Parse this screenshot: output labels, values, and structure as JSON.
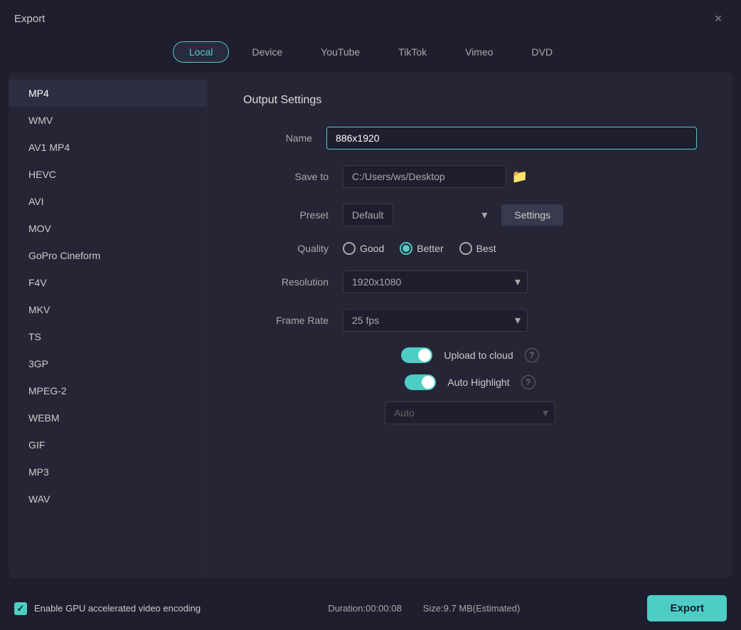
{
  "window": {
    "title": "Export",
    "close_icon": "×"
  },
  "tabs": [
    {
      "id": "local",
      "label": "Local",
      "active": true
    },
    {
      "id": "device",
      "label": "Device",
      "active": false
    },
    {
      "id": "youtube",
      "label": "YouTube",
      "active": false
    },
    {
      "id": "tiktok",
      "label": "TikTok",
      "active": false
    },
    {
      "id": "vimeo",
      "label": "Vimeo",
      "active": false
    },
    {
      "id": "dvd",
      "label": "DVD",
      "active": false
    }
  ],
  "formats": [
    {
      "label": "MP4",
      "active": true
    },
    {
      "label": "WMV",
      "active": false
    },
    {
      "label": "AV1 MP4",
      "active": false
    },
    {
      "label": "HEVC",
      "active": false
    },
    {
      "label": "AVI",
      "active": false
    },
    {
      "label": "MOV",
      "active": false
    },
    {
      "label": "GoPro Cineform",
      "active": false
    },
    {
      "label": "F4V",
      "active": false
    },
    {
      "label": "MKV",
      "active": false
    },
    {
      "label": "TS",
      "active": false
    },
    {
      "label": "3GP",
      "active": false
    },
    {
      "label": "MPEG-2",
      "active": false
    },
    {
      "label": "WEBM",
      "active": false
    },
    {
      "label": "GIF",
      "active": false
    },
    {
      "label": "MP3",
      "active": false
    },
    {
      "label": "WAV",
      "active": false
    }
  ],
  "settings": {
    "title": "Output Settings",
    "name_label": "Name",
    "name_value": "886x1920",
    "save_to_label": "Save to",
    "save_to_value": "C:/Users/ws/Desktop",
    "preset_label": "Preset",
    "preset_value": "Default",
    "settings_button": "Settings",
    "quality_label": "Quality",
    "quality_options": [
      {
        "id": "good",
        "label": "Good",
        "selected": false
      },
      {
        "id": "better",
        "label": "Better",
        "selected": true
      },
      {
        "id": "best",
        "label": "Best",
        "selected": false
      }
    ],
    "resolution_label": "Resolution",
    "resolution_value": "1920x1080",
    "frame_rate_label": "Frame Rate",
    "frame_rate_value": "25 fps",
    "upload_cloud_label": "Upload to cloud",
    "upload_cloud_on": true,
    "auto_highlight_label": "Auto Highlight",
    "auto_highlight_on": true,
    "auto_dropdown_value": "Auto"
  },
  "footer": {
    "gpu_label": "Enable GPU accelerated video encoding",
    "duration_label": "Duration:",
    "duration_value": "00:00:08",
    "size_label": "Size:",
    "size_value": "9.7 MB(Estimated)",
    "export_button": "Export"
  }
}
